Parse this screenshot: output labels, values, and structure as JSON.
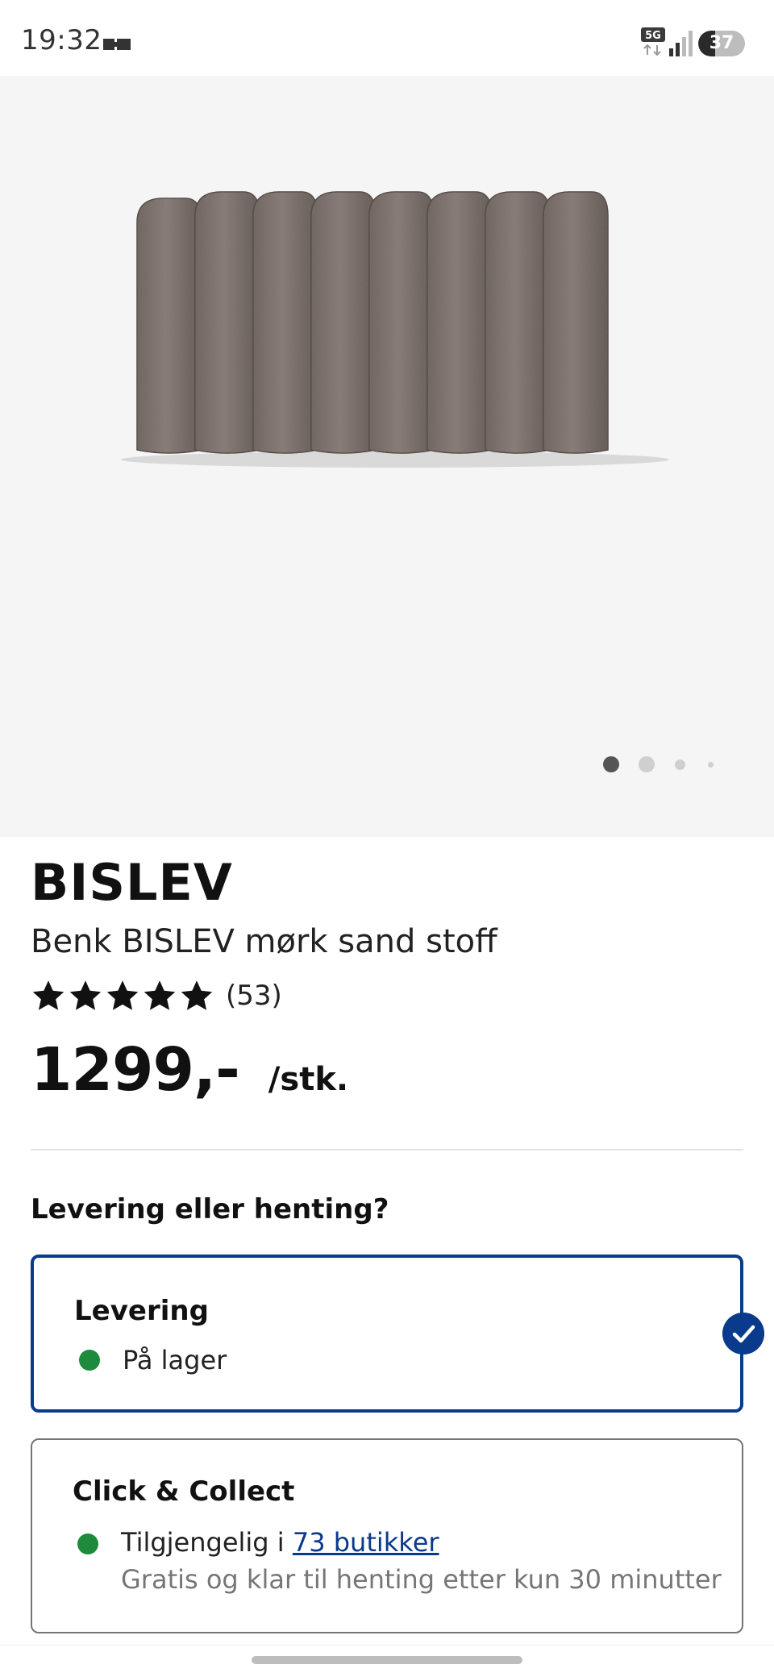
{
  "status_bar": {
    "time": "19:32",
    "network": "5G",
    "battery_percent": "37",
    "icons": [
      "media-icon",
      "network-5g-icon",
      "signal-icon",
      "battery-icon"
    ]
  },
  "gallery": {
    "image_count": 4,
    "active_index": 0
  },
  "product": {
    "name": "BISLEV",
    "description": "Benk BISLEV mørk sand stoff",
    "rating_stars": 5,
    "rating_count": "(53)",
    "price": "1299,-",
    "unit": "/stk."
  },
  "fulfilment": {
    "title": "Levering eller henting?",
    "delivery": {
      "title": "Levering",
      "status": "På lager",
      "selected": true
    },
    "click_collect": {
      "title": "Click & Collect",
      "available_prefix": "Tilgjengelig i ",
      "stores_link": "73 butikker",
      "note": "Gratis og klar til henting etter kun 30 minutter"
    }
  },
  "colors": {
    "accent_blue": "#0a3a8c",
    "in_stock_green": "#1e8a3c",
    "hero_background": "#f5f5f5",
    "product_fabric": "#7a6e68"
  }
}
